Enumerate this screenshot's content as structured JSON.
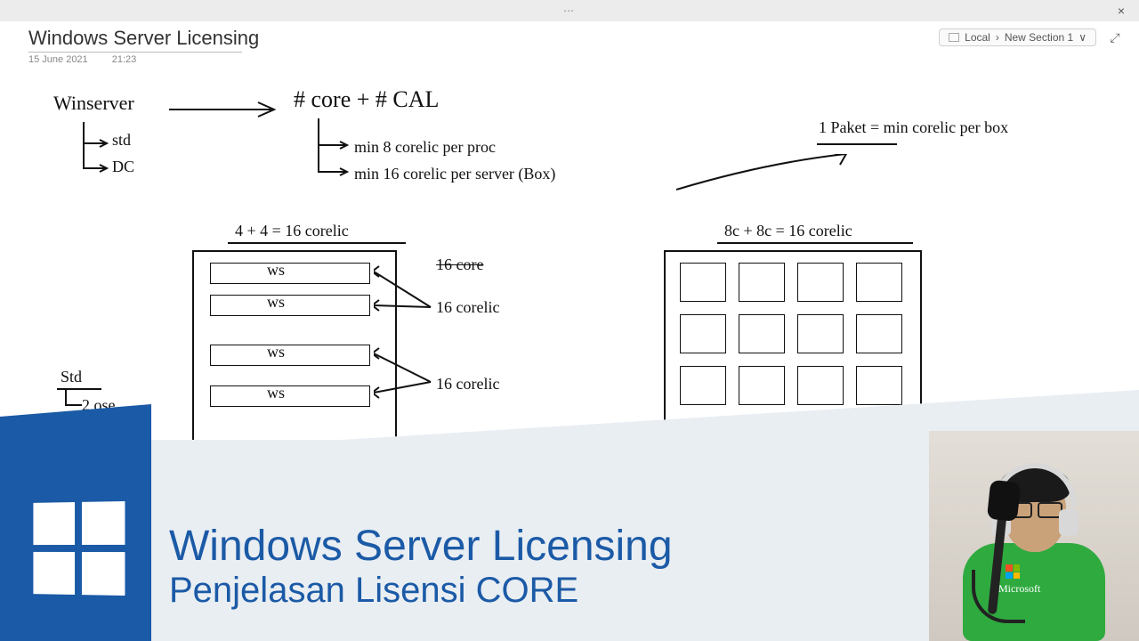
{
  "app": {
    "close_glyph": "×",
    "handle_glyph": "⋯"
  },
  "header": {
    "title": "Windows Server Licensing",
    "date": "15 June 2021",
    "time": "21:23",
    "breadcrumb_root": "Local",
    "breadcrumb_section": "New Section 1",
    "chevron": "∨",
    "expand_glyph": "⤢"
  },
  "notes": {
    "winserver": "Winserver",
    "std": "std",
    "dc": "DC",
    "core_cal": "# core   +   # CAL",
    "min8": "min  8  corelic  per proc",
    "min16": "min  16 corelic  per server (Box)",
    "paket": "1 Paket  =  min corelic per box",
    "left_eq": "4 + 4 = 16 corelic",
    "right_eq": "8c + 8c = 16 corelic",
    "ws": "ws",
    "sixteen1": "16 corelic",
    "sixteen2": "16 corelic",
    "strike": "16 core",
    "std_note": "Std",
    "twose": "2 ose"
  },
  "overlay": {
    "title": "Windows Server Licensing",
    "subtitle": "Penjelasan Lisensi CORE"
  },
  "colors": {
    "brand_blue": "#1b5aa6"
  }
}
